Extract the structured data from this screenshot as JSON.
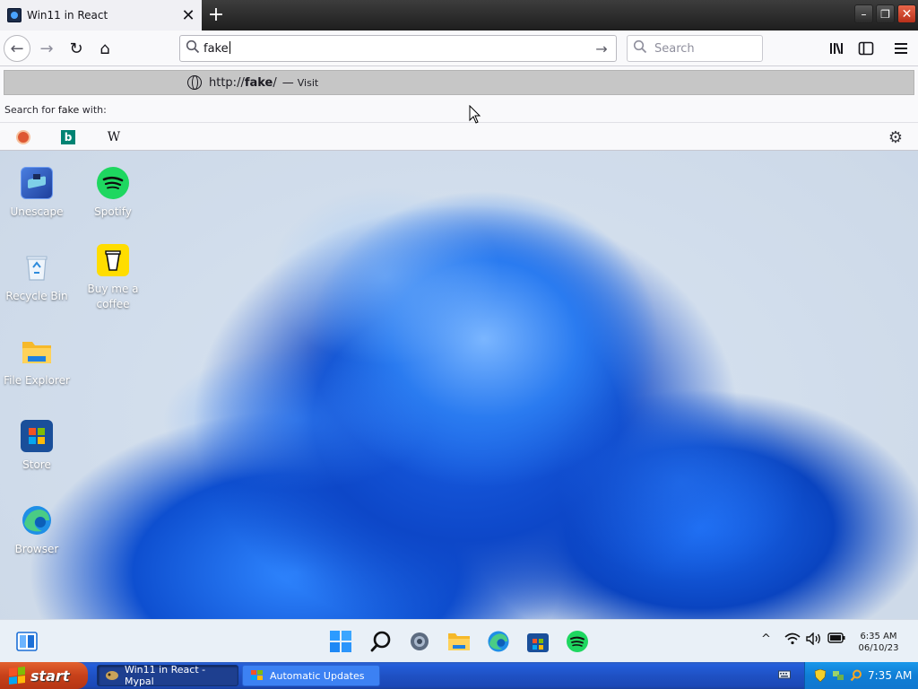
{
  "browser": {
    "tab": {
      "title": "Win11 in React",
      "close_glyph": "✕"
    },
    "newtab_glyph": "+",
    "window_controls": {
      "minimize": "–",
      "restore": "❐",
      "close": "✕"
    },
    "nav": {
      "back": "←",
      "forward": "→",
      "reload": "↻",
      "home": "⌂"
    },
    "urlbar": {
      "value": "fake",
      "go": "→"
    },
    "searchbar": {
      "placeholder": "Search"
    },
    "toolbar_right": {
      "library": "⫼",
      "sidebar": "▥",
      "menu": "≡"
    }
  },
  "dropdown": {
    "suggestion": {
      "prefix": "http://",
      "host": "fake",
      "suffix": "/",
      "dash": "—",
      "action": "Visit"
    },
    "search_with_prefix": "Search for ",
    "search_with_term": "fake",
    "search_with_suffix": " with:",
    "engines": [
      "duckduckgo-icon",
      "bing-icon",
      "wikipedia-icon"
    ],
    "bing_glyph": "b",
    "wiki_glyph": "W",
    "settings_glyph": "⚙"
  },
  "desktop": {
    "icons": [
      {
        "label": "Unescape"
      },
      {
        "label": "Spotify"
      },
      {
        "label": "Recycle Bin"
      },
      {
        "label": "Buy me a coffee"
      },
      {
        "label": "File Explorer"
      },
      {
        "label": "Store"
      },
      {
        "label": "Browser"
      }
    ]
  },
  "win11_taskbar": {
    "clock_time": "6:35 AM",
    "clock_date": "06/10/23",
    "tray_chevron": "^"
  },
  "xp_taskbar": {
    "start_label": "start",
    "tasks": [
      {
        "label": "Win11 in React - Mypal"
      },
      {
        "label": "Automatic Updates"
      }
    ],
    "clock": "7:35 AM"
  }
}
